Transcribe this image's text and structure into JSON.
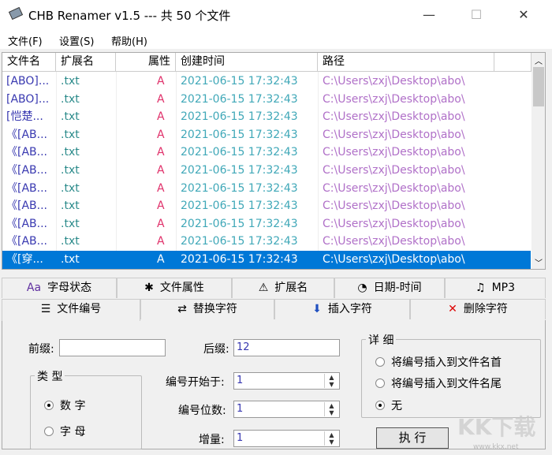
{
  "window": {
    "title": "CHB Renamer v1.5 --- 共 50 个文件",
    "minimize": "—",
    "maximize": "☐",
    "close": "✕"
  },
  "menu": [
    "文件(F)",
    "设置(S)",
    "帮助(H)"
  ],
  "columns": [
    "文件名",
    "扩展名",
    "属性",
    "创建时间",
    "路径"
  ],
  "rows": [
    {
      "name": "[ABO]...",
      "ext": ".txt",
      "attr": "A",
      "created": "2021-06-15 17:32:43",
      "path": "C:\\Users\\zxj\\Desktop\\abo\\"
    },
    {
      "name": "[ABO]...",
      "ext": ".txt",
      "attr": "A",
      "created": "2021-06-15 17:32:43",
      "path": "C:\\Users\\zxj\\Desktop\\abo\\"
    },
    {
      "name": "[恺楚...",
      "ext": ".txt",
      "attr": "A",
      "created": "2021-06-15 17:32:43",
      "path": "C:\\Users\\zxj\\Desktop\\abo\\"
    },
    {
      "name": "《[AB...",
      "ext": ".txt",
      "attr": "A",
      "created": "2021-06-15 17:32:43",
      "path": "C:\\Users\\zxj\\Desktop\\abo\\"
    },
    {
      "name": "《[AB...",
      "ext": ".txt",
      "attr": "A",
      "created": "2021-06-15 17:32:43",
      "path": "C:\\Users\\zxj\\Desktop\\abo\\"
    },
    {
      "name": "《[AB...",
      "ext": ".txt",
      "attr": "A",
      "created": "2021-06-15 17:32:43",
      "path": "C:\\Users\\zxj\\Desktop\\abo\\"
    },
    {
      "name": "《[AB...",
      "ext": ".txt",
      "attr": "A",
      "created": "2021-06-15 17:32:43",
      "path": "C:\\Users\\zxj\\Desktop\\abo\\"
    },
    {
      "name": "《[AB...",
      "ext": ".txt",
      "attr": "A",
      "created": "2021-06-15 17:32:43",
      "path": "C:\\Users\\zxj\\Desktop\\abo\\"
    },
    {
      "name": "《[AB...",
      "ext": ".txt",
      "attr": "A",
      "created": "2021-06-15 17:32:43",
      "path": "C:\\Users\\zxj\\Desktop\\abo\\"
    },
    {
      "name": "《[AB...",
      "ext": ".txt",
      "attr": "A",
      "created": "2021-06-15 17:32:43",
      "path": "C:\\Users\\zxj\\Desktop\\abo\\"
    },
    {
      "name": "《[穿...",
      "ext": ".txt",
      "attr": "A",
      "created": "2021-06-15 17:32:43",
      "path": "C:\\Users\\zxj\\Desktop\\abo\\",
      "selected": true
    }
  ],
  "tabs_row1": [
    {
      "icon": "Aa",
      "label": "字母状态"
    },
    {
      "icon": "✱",
      "label": "文件属性"
    },
    {
      "icon": "⚠",
      "label": "扩展名"
    },
    {
      "icon": "◔",
      "label": "日期-时间"
    },
    {
      "icon": "♫",
      "label": "MP3"
    }
  ],
  "tabs_row2": [
    {
      "icon": "☰",
      "label": "文件编号",
      "active": true
    },
    {
      "icon": "⇄",
      "label": "替换字符"
    },
    {
      "icon": "⬇",
      "label": "插入字符"
    },
    {
      "icon": "✕",
      "label": "删除字符"
    }
  ],
  "form": {
    "prefix_label": "前缀:",
    "prefix_value": "",
    "suffix_label": "后缀:",
    "suffix_value": "12",
    "start_label": "编号开始于:",
    "start_value": "1",
    "digits_label": "编号位数:",
    "digits_value": "1",
    "increment_label": "增量:",
    "increment_value": "1",
    "type_group": "类 型",
    "type_options": [
      "数 字",
      "字 母"
    ],
    "type_selected": 0,
    "detail_group": "详 细",
    "detail_options": [
      "将编号插入到文件名首",
      "将编号插入到文件名尾",
      "无"
    ],
    "detail_selected": 2,
    "execute": "执 行"
  },
  "watermark": "KK下载",
  "watermark_url": "www.kkx.net"
}
